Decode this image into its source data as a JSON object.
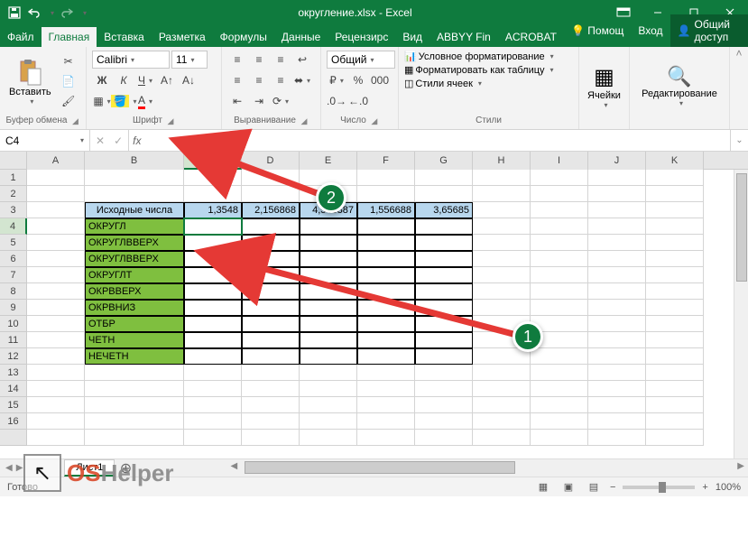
{
  "titlebar": {
    "title": "округление.xlsx - Excel"
  },
  "tabs": {
    "file": "Файл",
    "home": "Главная",
    "insert": "Вставка",
    "layout": "Разметка",
    "formulas": "Формулы",
    "data": "Данные",
    "review": "Рецензирс",
    "view": "Вид",
    "abbyy": "ABBYY Fin",
    "acrobat": "ACROBAT",
    "help": "Помощ",
    "login": "Вход",
    "share": "Общий доступ"
  },
  "ribbon": {
    "paste": "Вставить",
    "clipboard": "Буфер обмена",
    "font_name": "Calibri",
    "font_size": "11",
    "font_group": "Шрифт",
    "align_group": "Выравнивание",
    "number_format": "Общий",
    "number_group": "Число",
    "cond_format": "Условное форматирование",
    "format_table": "Форматировать как таблицу",
    "cell_styles": "Стили ячеек",
    "styles_group": "Стили",
    "cells_group": "Ячейки",
    "editing_group": "Редактирование"
  },
  "namebox": "C4",
  "sheet": {
    "columns": [
      "A",
      "B",
      "C",
      "D",
      "E",
      "F",
      "G",
      "H",
      "I",
      "J",
      "K"
    ],
    "rows_header": [
      1,
      2,
      3,
      4,
      5,
      6,
      7,
      8,
      9,
      10,
      11,
      12,
      13,
      14,
      15,
      16
    ],
    "b3": "Исходные числа",
    "c3": "1,3548",
    "d3": "2,156868",
    "e3": "4,546887",
    "f3": "1,556688",
    "g3": "3,65685",
    "b4": "ОКРУГЛ",
    "b5": "ОКРУГЛВВЕРХ",
    "b6": "ОКРУГЛВВЕРХ",
    "b7": "ОКРУГЛТ",
    "b8": "ОКРВВЕРХ",
    "b9": "ОКРВНИЗ",
    "b10": "ОТБР",
    "b11": "ЧЕТН",
    "b12": "НЕЧЕТН",
    "tab": "Лист1"
  },
  "status": {
    "ready": "Готово",
    "zoom": "100%"
  },
  "annot": {
    "one": "1",
    "two": "2"
  },
  "watermark": {
    "os": "OS",
    "helper": "Helper"
  }
}
